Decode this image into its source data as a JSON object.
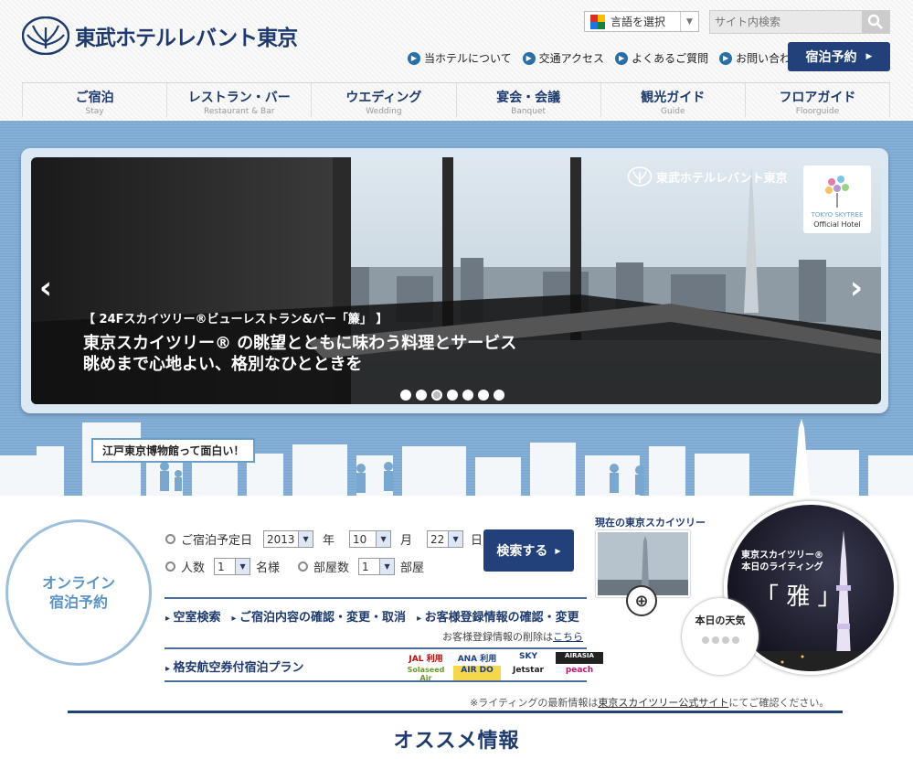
{
  "header": {
    "logo_text": "東武ホテルレバント東京",
    "language_selector": "言語を選択",
    "search_placeholder": "サイト内検索",
    "util_links": [
      "当ホテルについて",
      "交通アクセス",
      "よくあるご質問",
      "お問い合わせ"
    ],
    "reserve_button": "宿泊予約"
  },
  "gnav": [
    {
      "ja": "ご宿泊",
      "en": "Stay"
    },
    {
      "ja": "レストラン・バー",
      "en": "Restaurant & Bar"
    },
    {
      "ja": "ウエディング",
      "en": "Wedding"
    },
    {
      "ja": "宴会・会議",
      "en": "Banquet"
    },
    {
      "ja": "観光ガイド",
      "en": "Guide"
    },
    {
      "ja": "フロアガイド",
      "en": "Floorguide"
    }
  ],
  "slide": {
    "subtitle": "【 24Fスカイツリー®ビューレストラン&バー「簾」 】",
    "title_line1": "東京スカイツリー® の眺望とともに味わう料理とサービス",
    "title_line2": "眺めまで心地よい、格別なひとときを",
    "overlay_logo": "東武ホテルレバント東京",
    "badge_tree": "TOKYO SKYTREE",
    "badge_official": "Official Hotel",
    "dot_count": 7,
    "active_dot": 2
  },
  "edo_label": "江戸東京博物館って面白い！",
  "booking": {
    "online_title": [
      "オンライン",
      "宿泊予約"
    ],
    "checkin_label": "ご宿泊予定日",
    "year": "2013",
    "year_label": "年",
    "month": "10",
    "month_label": "月",
    "day": "22",
    "day_label": "日",
    "guests_label": "人数",
    "guests": "1",
    "guests_unit": "名様",
    "rooms_label": "部屋数",
    "rooms": "1",
    "rooms_unit": "部屋",
    "search_button": "検索する",
    "links": [
      "空室検索",
      "ご宿泊内容の確認・変更・取消",
      "お客様登録情報の確認・変更"
    ],
    "delete_note": "お客様登録情報の削除は",
    "delete_link": "こちら",
    "flight_plan": "格安航空券付宿泊プラン",
    "airlines": [
      "JAL 利用",
      "ANA 利用",
      "SKY",
      "AIRASIA",
      "Solaseed Air",
      "AIR DO",
      "Jetstar",
      "peach"
    ]
  },
  "skytree": {
    "current_label": "現在の東京スカイツリー",
    "lighting_label_1": "東京スカイツリー®",
    "lighting_label_2": "本日のライティング",
    "lighting_name": "「 雅 」",
    "weather_label": "本日の天気",
    "note_prefix": "※ライティングの最新情報は",
    "note_link": "東京スカイツリー公式サイト",
    "note_suffix": "にてご確認ください。"
  },
  "recommend_title": "オススメ情報",
  "colors": {
    "navy": "#22407a",
    "sky": "#7aa7cf",
    "link_blue": "#1e3a6e"
  }
}
